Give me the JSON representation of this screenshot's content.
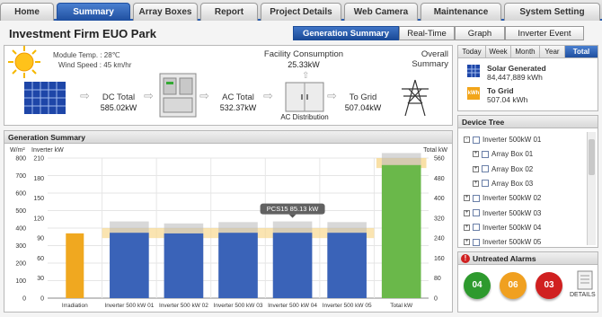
{
  "nav": {
    "tabs": [
      {
        "label": "Home"
      },
      {
        "label": "Summary"
      },
      {
        "label": "Array Boxes"
      },
      {
        "label": "Report"
      },
      {
        "label": "Project Details"
      },
      {
        "label": "Web Camera"
      },
      {
        "label": "Maintenance"
      },
      {
        "label": "System Setting"
      }
    ],
    "active": "Summary"
  },
  "header": {
    "title": "Investment Firm EUO Park",
    "subtabs": [
      "Generation Summary",
      "Real-Time",
      "Graph",
      "Inverter Event"
    ],
    "active_subtab": "Generation Summary"
  },
  "flow": {
    "module_temp": "Module Temp. : 28℃",
    "wind_speed": "Wind Speed : 45 km/hr",
    "dc_total_label": "DC Total",
    "dc_total_value": "585.02kW",
    "ac_total_label": "AC Total",
    "ac_total_value": "532.37kW",
    "facility_label": "Facility Consumption",
    "facility_value": "25.33kW",
    "ac_distribution": "AC Distribution",
    "to_grid_label": "To Grid",
    "to_grid_value": "507.04kW",
    "overall_line1": "Overall",
    "overall_line2": "Summary"
  },
  "period": {
    "tabs": [
      "Today",
      "Week",
      "Month",
      "Year",
      "Total"
    ],
    "active": "Total",
    "solar_label": "Solar Generated",
    "solar_value": "84,447,889 kWh",
    "grid_label": "To Grid",
    "grid_value": "507.04 kWh",
    "kwh_badge": "kWh"
  },
  "device_tree": {
    "title": "Device Tree",
    "items": [
      {
        "label": "Inverter 500kW 01",
        "level": 0,
        "toggle": "-"
      },
      {
        "label": "Array Box 01",
        "level": 1,
        "toggle": "+"
      },
      {
        "label": "Array Box 02",
        "level": 1,
        "toggle": "+"
      },
      {
        "label": "Array Box 03",
        "level": 1,
        "toggle": "+"
      },
      {
        "label": "Inverter 500kW 02",
        "level": 0,
        "toggle": "+"
      },
      {
        "label": "Inverter 500kW 03",
        "level": 0,
        "toggle": "+"
      },
      {
        "label": "Inverter 500kW 04",
        "level": 0,
        "toggle": "+"
      },
      {
        "label": "Inverter 500kW 05",
        "level": 0,
        "toggle": "+"
      }
    ]
  },
  "alarms": {
    "title": "Untreated Alarms",
    "counts": [
      {
        "value": "04",
        "color": "#2e9a2e"
      },
      {
        "value": "06",
        "color": "#f0a020"
      },
      {
        "value": "03",
        "color": "#d02020"
      }
    ],
    "details_label": "DETAILS"
  },
  "chart": {
    "title": "Generation Summary",
    "left_unit": "W/m²",
    "inverter_unit": "Inverter kW",
    "right_unit": "Total kW",
    "tooltip": "PCS15 85.13 kW"
  },
  "chart_data": {
    "type": "bar",
    "categories": [
      "Irradiation",
      "Inverter 500 kW 01",
      "Inverter 500 kW 02",
      "Inverter 500 kW 03",
      "Inverter 500 kW 04",
      "Inverter 500 kW 05",
      "Total kW"
    ],
    "irradiation_axis": {
      "ticks": [
        0,
        100,
        200,
        300,
        400,
        500,
        600,
        700,
        800
      ],
      "ylim": [
        0,
        800
      ]
    },
    "inverter_axis": {
      "ticks": [
        0,
        30,
        60,
        90,
        120,
        150,
        180,
        210
      ],
      "ylim": [
        0,
        210
      ]
    },
    "total_axis": {
      "ticks": [
        0,
        80,
        160,
        240,
        320,
        400,
        480,
        560
      ],
      "ylim": [
        0,
        560
      ]
    },
    "irradiation_value": 370,
    "inverter_values": [
      98,
      97,
      98,
      98,
      98
    ],
    "inverter_capacity": [
      115,
      112,
      114,
      115,
      114
    ],
    "inverter_band": [
      90,
      105
    ],
    "total_value": 532,
    "total_capacity": 580,
    "total_band": [
      520,
      560
    ],
    "colors": {
      "irradiation": "#f0a820",
      "inverter": "#3a63b8",
      "total": "#6ab84a",
      "capacity": "#b8b8b8",
      "band": "#f8d890"
    }
  }
}
